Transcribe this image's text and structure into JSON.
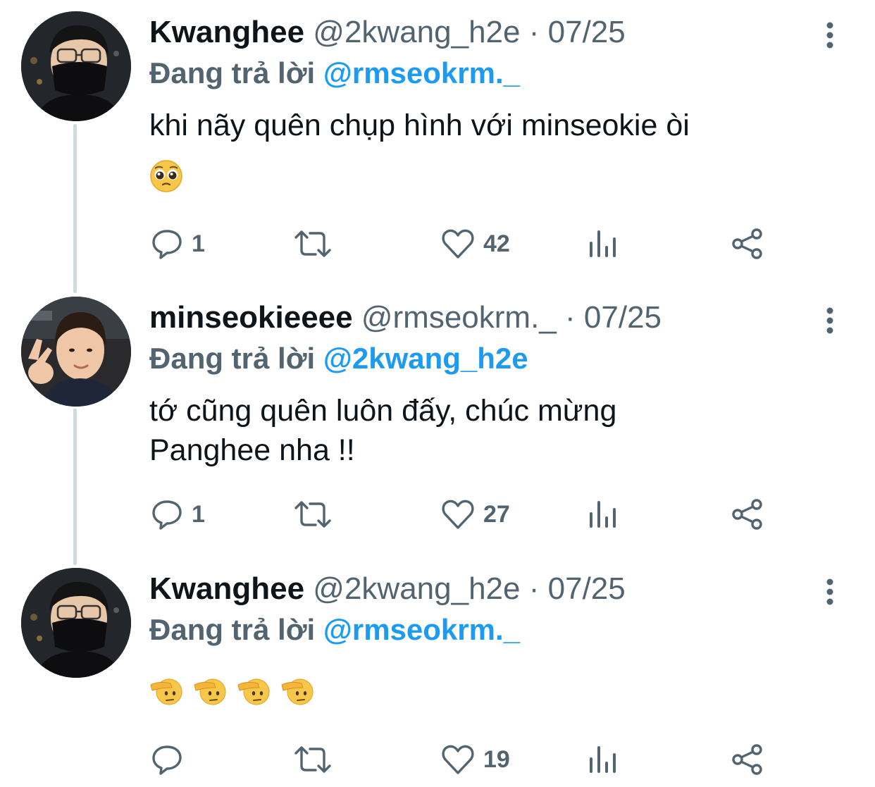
{
  "tweets": [
    {
      "name": "Kwanghee",
      "handle": "@2kwang_h2e",
      "sep": "·",
      "date": "07/25",
      "reply_prefix": "Đang trả lời",
      "reply_to": "@rmseokrm._",
      "text": "khi nãy quên chụp hình với minseokie òi",
      "emojis": [
        "pleading-face"
      ],
      "replies": "1",
      "retweets": "",
      "likes": "42"
    },
    {
      "name": "minseokieeee",
      "handle": "@rmseokrm._",
      "sep": "·",
      "date": "07/25",
      "reply_prefix": "Đang trả lời",
      "reply_to": "@2kwang_h2e",
      "text": "tớ cũng quên luôn đấy, chúc mừng Panghee nha !!",
      "emojis": [],
      "replies": "1",
      "retweets": "",
      "likes": "27"
    },
    {
      "name": "Kwanghee",
      "handle": "@2kwang_h2e",
      "sep": "·",
      "date": "07/25",
      "reply_prefix": "Đang trả lời",
      "reply_to": "@rmseokrm._",
      "text": "",
      "emojis": [
        "saluting-face",
        "saluting-face",
        "saluting-face",
        "saluting-face"
      ],
      "replies": "",
      "retweets": "",
      "likes": "19"
    }
  ],
  "colors": {
    "text_primary": "#0f1419",
    "text_secondary": "#536471",
    "link": "#1d9bf0",
    "thread_line": "#cfd9de"
  },
  "icons": [
    "reply-icon",
    "retweet-icon",
    "like-icon",
    "views-icon",
    "share-icon",
    "more-icon"
  ]
}
